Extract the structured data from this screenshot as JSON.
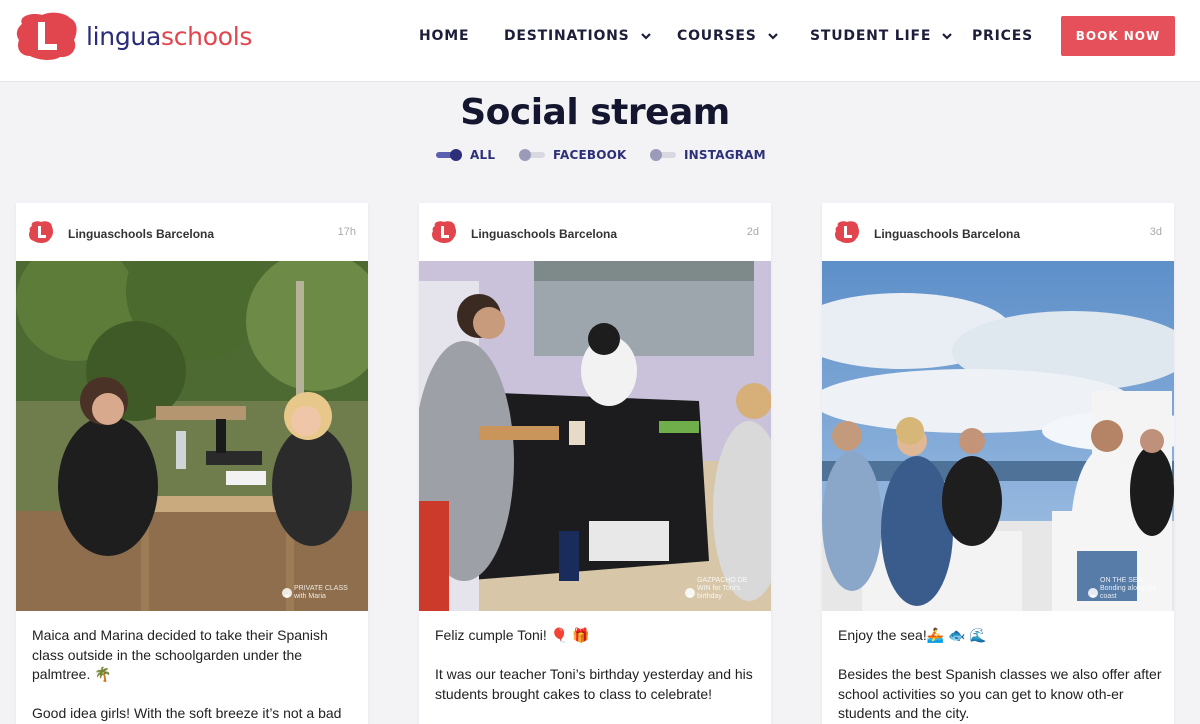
{
  "brand": {
    "name_part1": "lingua",
    "name_part2": "schools",
    "accent": "#e1454e",
    "navy": "#2a2c7a"
  },
  "nav": {
    "items": [
      {
        "label": "HOME",
        "has_dropdown": false
      },
      {
        "label": "DESTINATIONS",
        "has_dropdown": true
      },
      {
        "label": "COURSES",
        "has_dropdown": true
      },
      {
        "label": "STUDENT LIFE",
        "has_dropdown": true
      },
      {
        "label": "PRICES",
        "has_dropdown": false
      }
    ],
    "book_button": "BOOK NOW"
  },
  "page": {
    "title": "Social stream"
  },
  "filters": [
    {
      "label": "ALL",
      "active": true
    },
    {
      "label": "FACEBOOK",
      "active": false
    },
    {
      "label": "INSTAGRAM",
      "active": false
    }
  ],
  "posts": [
    {
      "author": "Linguaschools Barcelona",
      "time": "17h",
      "photo_caption": "PRIVATE CLASS with Maria",
      "paragraphs": [
        "Maica and Marina decided to take their Spanish class outside in the schoolgarden under the palmtree. 🌴",
        "Good idea girls! With the soft breeze it’s not a bad"
      ]
    },
    {
      "author": "Linguaschools Barcelona",
      "time": "2d",
      "photo_caption": "GAZPACHO DE WIN for Toni's birthday",
      "paragraphs": [
        "Feliz cumple Toni! 🎈 🎁",
        "It was our teacher Toni’s birthday yesterday and his students brought cakes to class to celebrate!"
      ]
    },
    {
      "author": "Linguaschools Barcelona",
      "time": "3d",
      "photo_caption": "ON THE SEA Bonding along the coast",
      "paragraphs": [
        "Enjoy the sea!🚣 🐟 🌊",
        "Besides the best Spanish classes we also offer after school activities so you can get to know oth-er students and the city."
      ]
    }
  ]
}
